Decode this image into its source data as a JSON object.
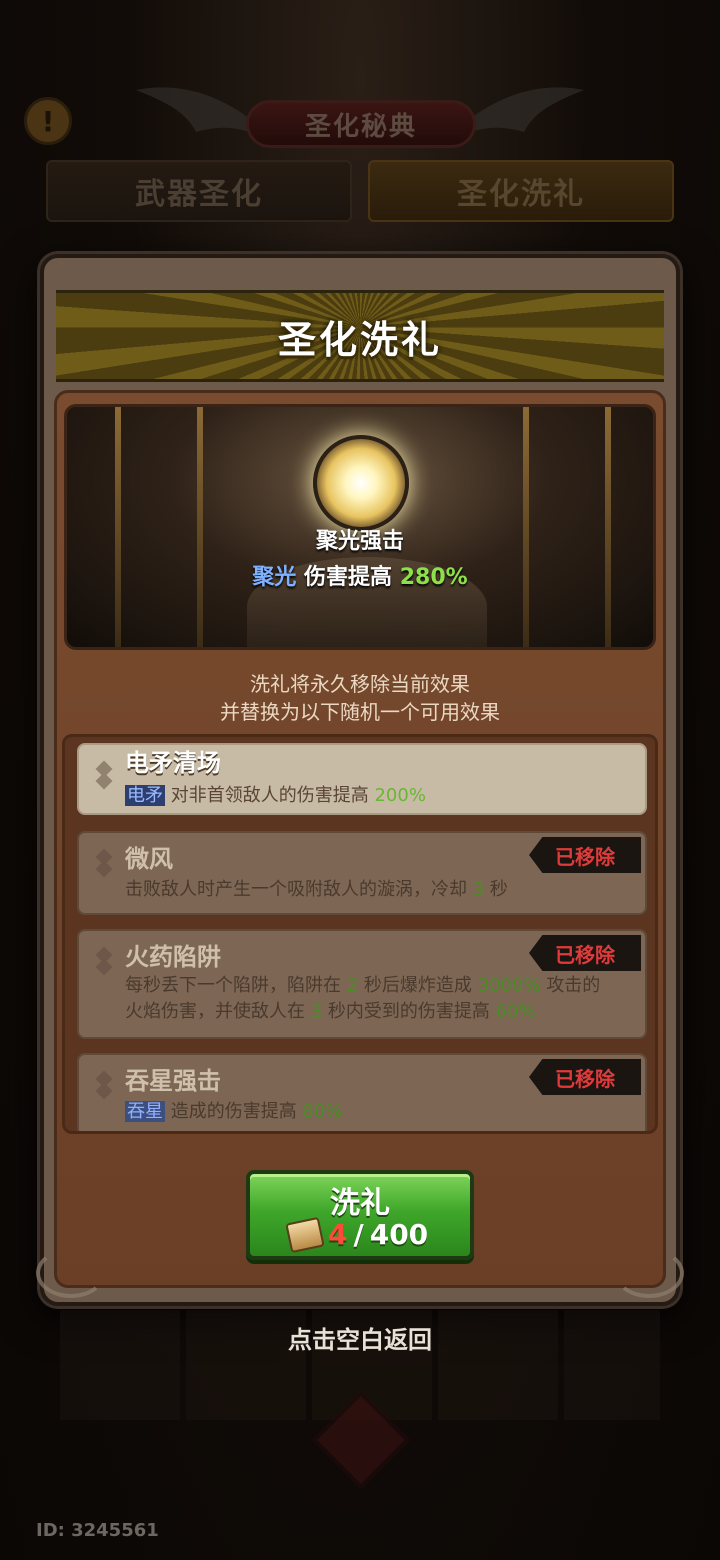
{
  "header": {
    "title": "圣化秘典",
    "info_icon": "exclamation-icon"
  },
  "tabs": [
    {
      "label": "武器圣化",
      "active": false
    },
    {
      "label": "圣化洗礼",
      "active": true
    }
  ],
  "panel": {
    "banner_title": "圣化洗礼",
    "current_skill": {
      "name": "聚光强击",
      "tag": "聚光",
      "desc_text": "伤害提高",
      "value": "280%"
    },
    "notice_line1": "洗礼将永久移除当前效果",
    "notice_line2": "并替换为以下随机一个可用效果",
    "options": [
      {
        "title": "电矛清场",
        "tag": "电矛",
        "desc": "对非首领敌人的伤害提高",
        "value": "200%"
      },
      {
        "title": "微风",
        "desc": "击败敌人时产生一个吸附敌人的漩涡，冷却",
        "value": "3",
        "unit": "秒",
        "status": "已移除"
      },
      {
        "title": "火药陷阱",
        "desc_a": "每秒丢下一个陷阱，陷阱在",
        "v1": "2",
        "desc_b": "秒后爆炸造成",
        "v2": "3000%",
        "desc_c": "攻击的",
        "desc_d": "火焰伤害，并使敌人在",
        "v3": "3",
        "desc_e": "秒内受到的伤害提高",
        "v4": "60%",
        "status": "已移除"
      },
      {
        "title": "吞星强击",
        "tag": "吞星",
        "desc": "造成的伤害提高",
        "value": "80%",
        "status": "已移除"
      }
    ],
    "button": {
      "label": "洗礼",
      "cost_have": "4",
      "cost_sep": "/",
      "cost_need": "400"
    }
  },
  "back_hint": "点击空白返回",
  "user_id": "ID: 3245561",
  "colors": {
    "accent_green": "#8ee04a",
    "removed_red": "#e03b3b",
    "tag_blue": "#7fb1ff"
  }
}
